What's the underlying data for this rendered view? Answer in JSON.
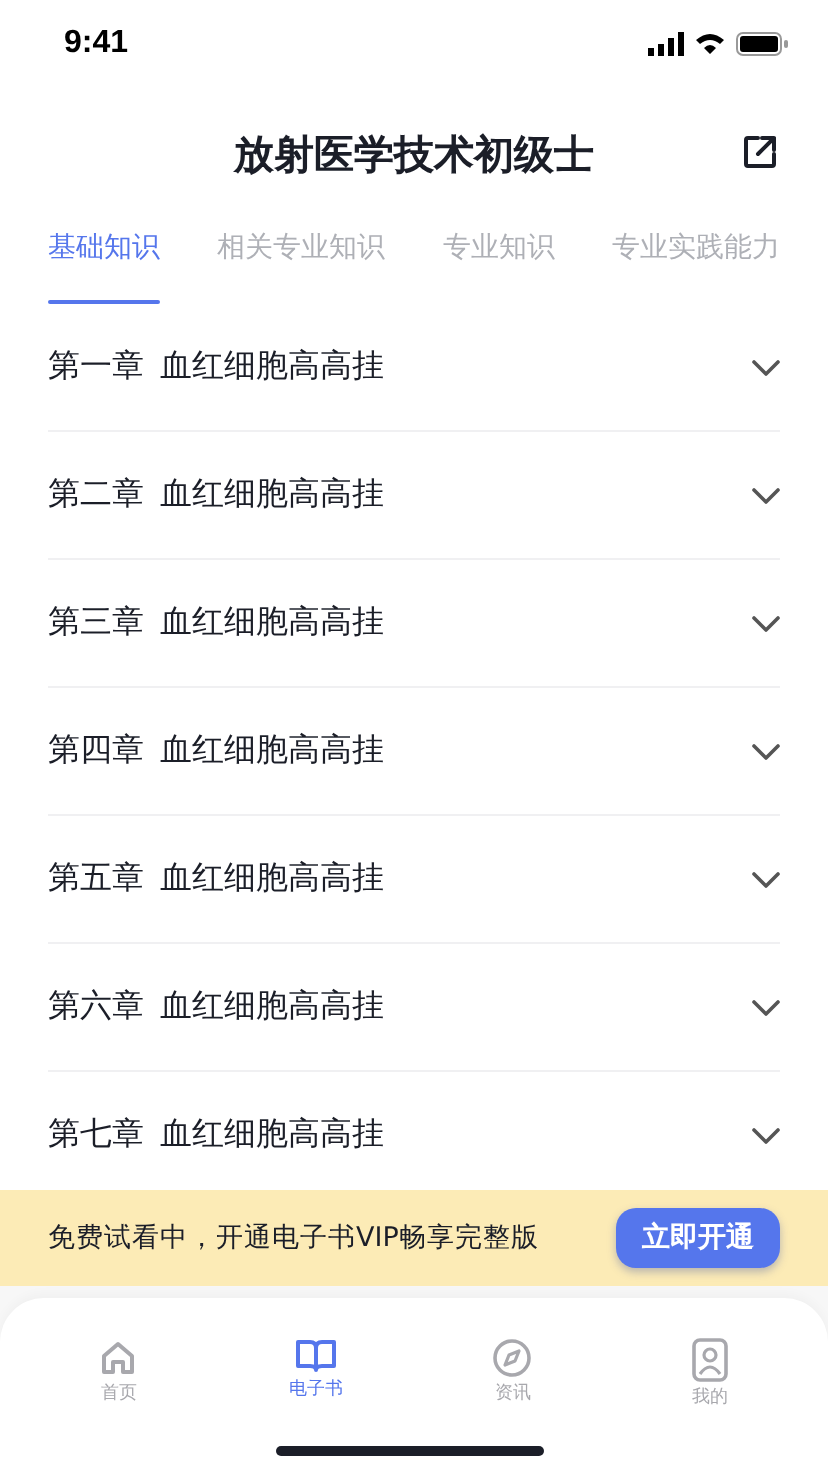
{
  "status_bar": {
    "time": "9:41"
  },
  "header": {
    "title": "放射医学技术初级士"
  },
  "tabs": [
    {
      "label": "基础知识",
      "selected": true
    },
    {
      "label": "相关专业知识",
      "selected": false
    },
    {
      "label": "专业知识",
      "selected": false
    },
    {
      "label": "专业实践能力",
      "selected": false
    }
  ],
  "chapters": [
    {
      "number": "第一章",
      "title": "血红细胞高高挂",
      "expanded": false
    },
    {
      "number": "第二章",
      "title": "血红细胞高高挂",
      "expanded": false
    },
    {
      "number": "第三章",
      "title": "血红细胞高高挂",
      "expanded": false
    },
    {
      "number": "第四章",
      "title": "血红细胞高高挂",
      "expanded": false
    },
    {
      "number": "第五章",
      "title": "血红细胞高高挂",
      "expanded": false
    },
    {
      "number": "第六章",
      "title": "血红细胞高高挂",
      "expanded": false
    },
    {
      "number": "第七章",
      "title": "血红细胞高高挂",
      "expanded": false
    }
  ],
  "promo_banner": {
    "text": "免费试看中，开通电子书VIP畅享完整版",
    "button": "立即开通"
  },
  "tab_bar": [
    {
      "kind": "home",
      "label": "首页",
      "selected": false
    },
    {
      "kind": "book",
      "label": "电子书",
      "selected": true
    },
    {
      "kind": "compass",
      "label": "资讯",
      "selected": false
    },
    {
      "kind": "person",
      "label": "我的",
      "selected": false
    }
  ]
}
